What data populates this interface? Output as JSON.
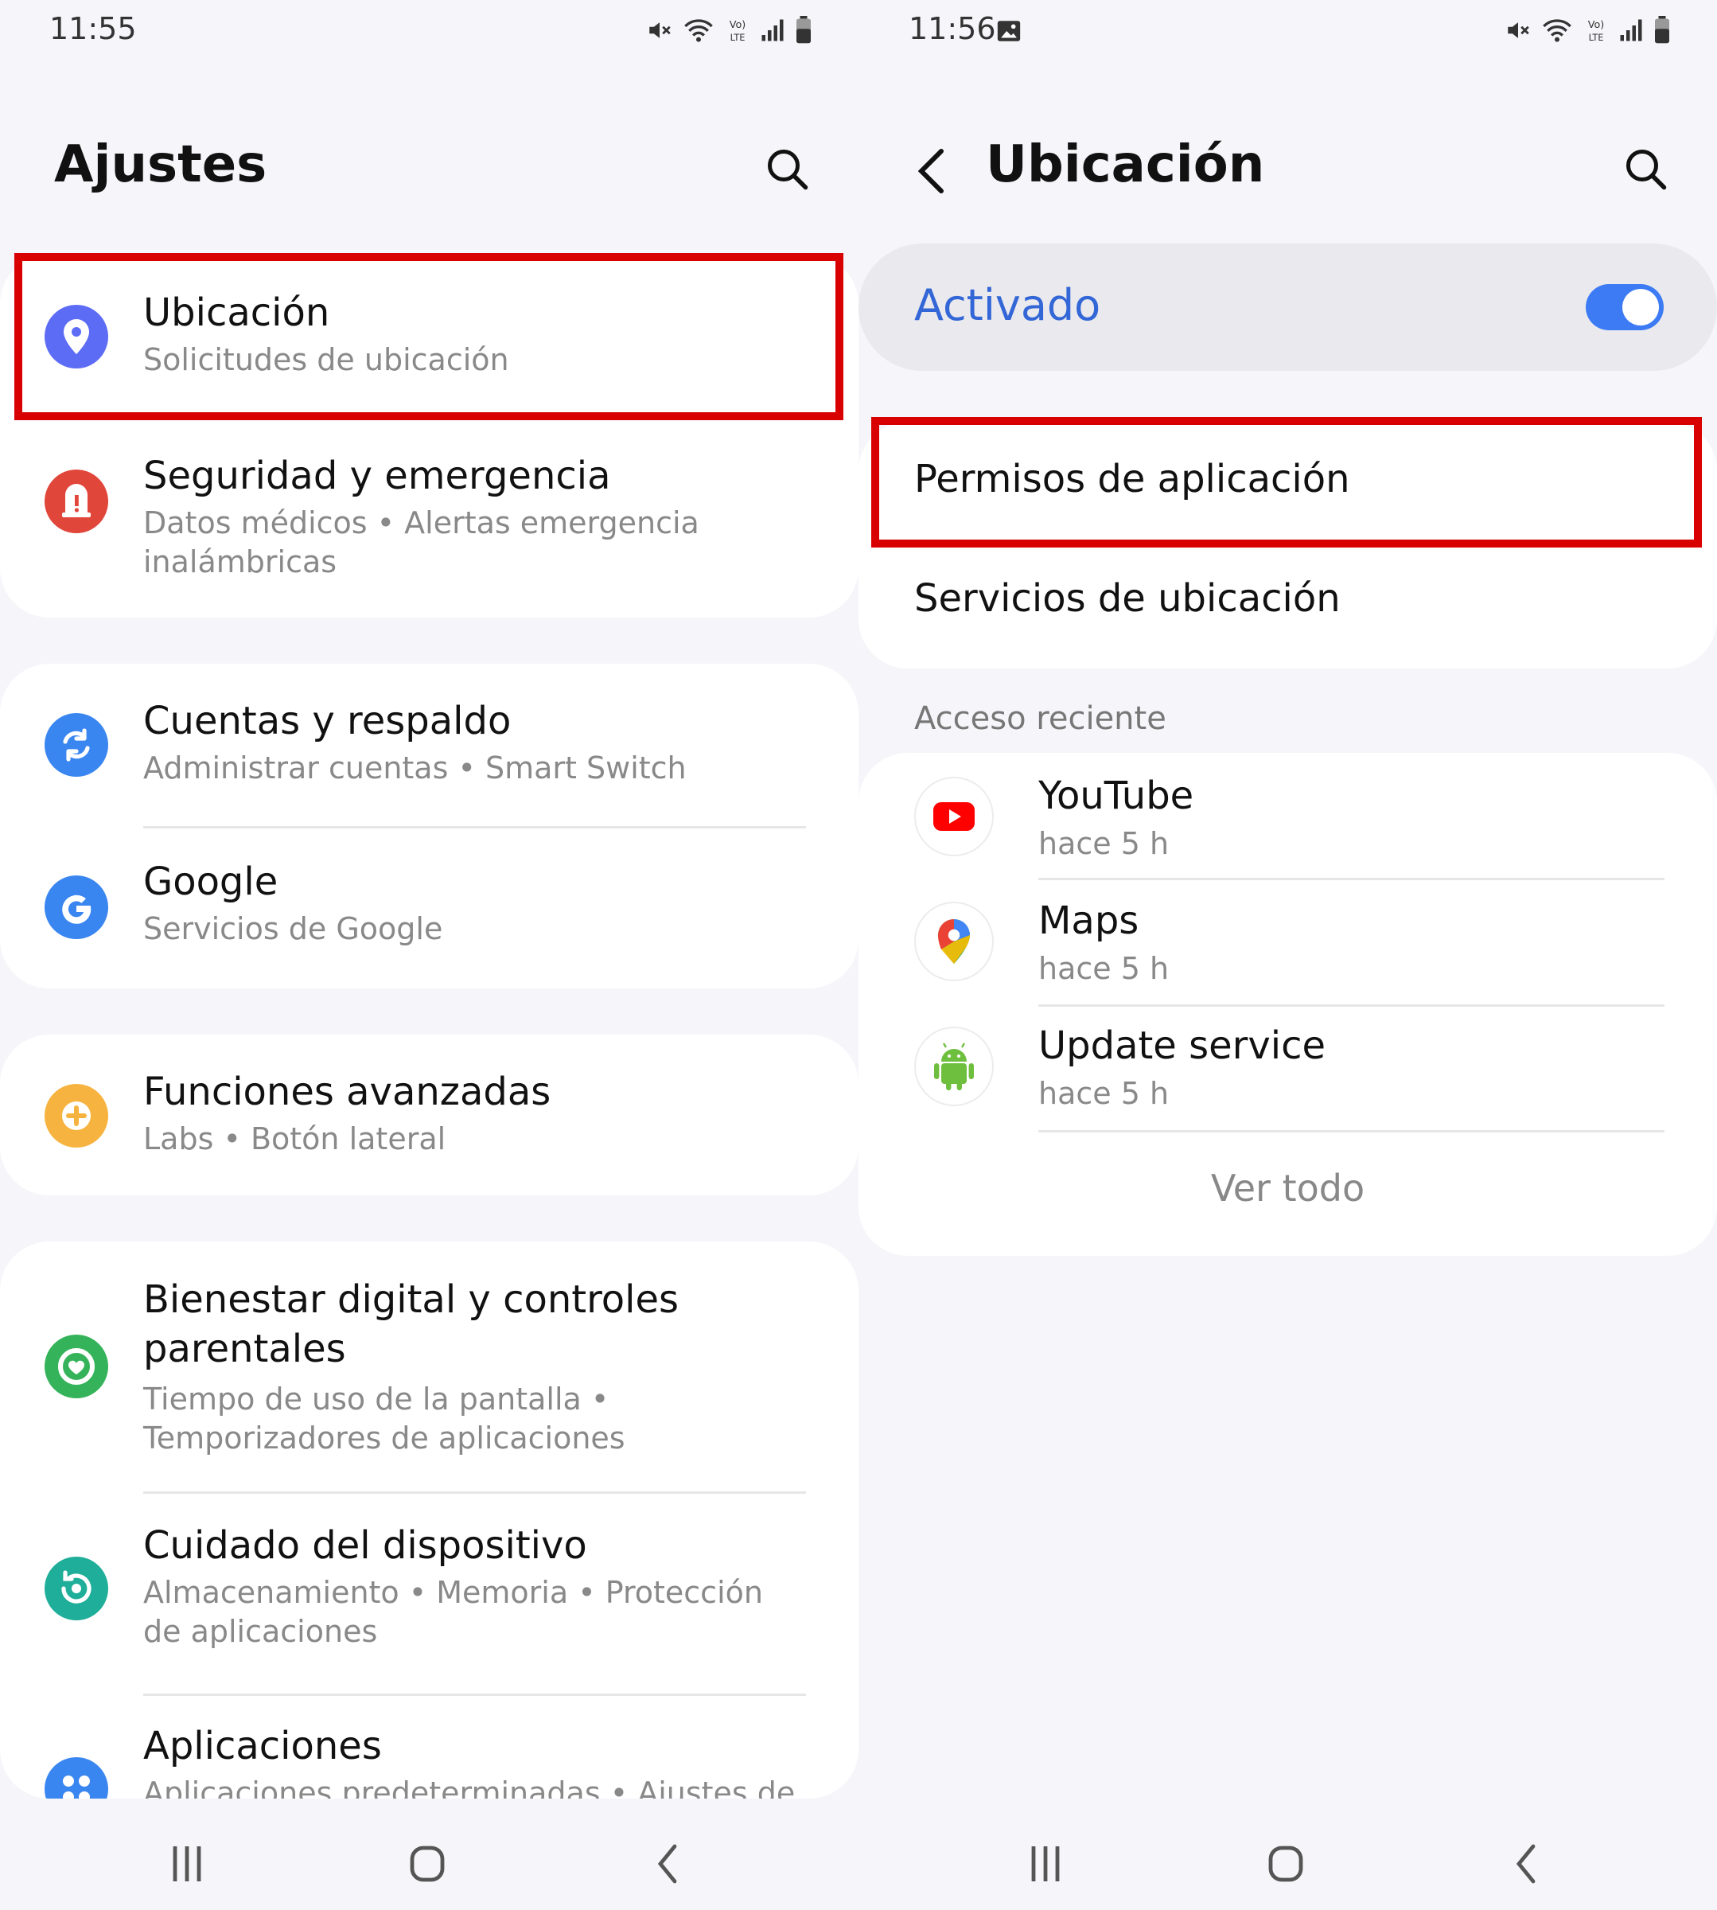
{
  "left": {
    "status_time": "11:55",
    "title": "Ajustes",
    "items": [
      {
        "title": "Ubicación",
        "subtitle": "Solicitudes de ubicación",
        "icon": "location-pin-icon",
        "color": "#5d6cf5"
      },
      {
        "title": "Seguridad y emergencia",
        "subtitle": "Datos médicos • Alertas emergencia inalámbricas",
        "icon": "alert-icon",
        "color": "#e1463a"
      },
      {
        "title": "Cuentas y respaldo",
        "subtitle": "Administrar cuentas • Smart Switch",
        "icon": "sync-icon",
        "color": "#3a86f1"
      },
      {
        "title": "Google",
        "subtitle": "Servicios de Google",
        "icon": "google-icon",
        "color": "#3a86f1"
      },
      {
        "title": "Funciones avanzadas",
        "subtitle": "Labs • Botón lateral",
        "icon": "plus-gear-icon",
        "color": "#f7b33f"
      },
      {
        "title": "Bienestar digital y controles parentales",
        "subtitle": "Tiempo de uso de la pantalla • Temporizadores de aplicaciones",
        "icon": "wellbeing-icon",
        "color": "#35b35a"
      },
      {
        "title": "Cuidado del dispositivo",
        "subtitle": "Almacenamiento • Memoria • Protección de aplicaciones",
        "icon": "device-care-icon",
        "color": "#1fae99"
      },
      {
        "title": "Aplicaciones",
        "subtitle": "Aplicaciones predeterminadas • Ajustes de",
        "icon": "apps-icon",
        "color": "#3a86f1"
      }
    ]
  },
  "right": {
    "status_time": "11:56",
    "title": "Ubicación",
    "toggle_label": "Activado",
    "toggle_on": true,
    "menu": [
      {
        "label": "Permisos de aplicación"
      },
      {
        "label": "Servicios de ubicación"
      }
    ],
    "recent_header": "Acceso reciente",
    "recent": [
      {
        "name": "YouTube",
        "time": "hace 5 h",
        "icon": "youtube-icon"
      },
      {
        "name": "Maps",
        "time": "hace 5 h",
        "icon": "maps-icon"
      },
      {
        "name": "Update service",
        "time": "hace 5 h",
        "icon": "android-icon"
      }
    ],
    "see_all": "Ver todo"
  },
  "colors": {
    "accent": "#3d7bf5",
    "highlight": "#d80000",
    "background": "#f6f6fa"
  }
}
